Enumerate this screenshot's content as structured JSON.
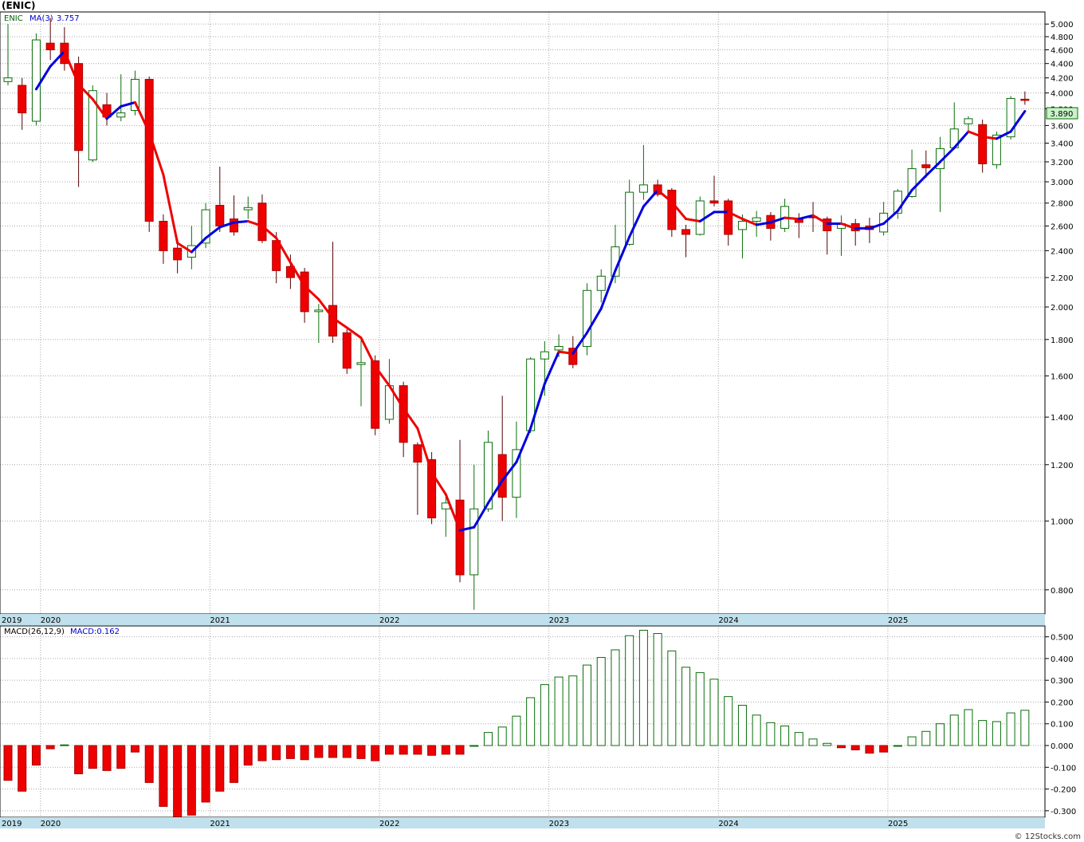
{
  "header": {
    "symbol": "(ENIC)"
  },
  "watermark": "© 12Stocks.com",
  "colors": {
    "up_body": "#ffffff",
    "up_stroke": "#0a6e0a",
    "down_body": "#ee0000",
    "down_stroke": "#aa0000",
    "ma_up": "#0000dd",
    "ma_down": "#ee0000",
    "axis_band": "#bfe0ec",
    "price_tag": "#c9f2c9"
  },
  "chart_data": [
    {
      "type": "candlestick",
      "panel": "price",
      "legend": {
        "symbol": "ENIC",
        "ma_label": "MA(3)",
        "ma_value": "3.757"
      },
      "last_price": "3.890",
      "y_scale": "log",
      "ylim": [
        0.74,
        5.2
      ],
      "y_ticks": [
        {
          "v": 0.8,
          "label": "0.800"
        },
        {
          "v": 1.0,
          "label": "1.000"
        },
        {
          "v": 1.2,
          "label": "1.200"
        },
        {
          "v": 1.4,
          "label": "1.400"
        },
        {
          "v": 1.6,
          "label": "1.600"
        },
        {
          "v": 1.8,
          "label": "1.800"
        },
        {
          "v": 2.0,
          "label": "2.000"
        },
        {
          "v": 2.2,
          "label": "2.200"
        },
        {
          "v": 2.4,
          "label": "2.400"
        },
        {
          "v": 2.6,
          "label": "2.600"
        },
        {
          "v": 2.8,
          "label": "2.800"
        },
        {
          "v": 3.0,
          "label": "3.000"
        },
        {
          "v": 3.2,
          "label": "3.200"
        },
        {
          "v": 3.4,
          "label": "3.400"
        },
        {
          "v": 3.6,
          "label": "3.600"
        },
        {
          "v": 3.8,
          "label": "3.800"
        },
        {
          "v": 4.0,
          "label": "4.000"
        },
        {
          "v": 4.2,
          "label": "4.200"
        },
        {
          "v": 4.4,
          "label": "4.400"
        },
        {
          "v": 4.6,
          "label": "4.600"
        },
        {
          "v": 4.8,
          "label": "4.800"
        },
        {
          "v": 5.0,
          "label": "5.000"
        }
      ],
      "x_labels": [
        {
          "i": -0.7,
          "label": "2019"
        },
        {
          "i": 2.3,
          "label": "2020"
        },
        {
          "i": 14.3,
          "label": "2021"
        },
        {
          "i": 26.3,
          "label": "2022"
        },
        {
          "i": 38.3,
          "label": "2023"
        },
        {
          "i": 50.3,
          "label": "2024"
        },
        {
          "i": 62.3,
          "label": "2025"
        }
      ],
      "candles": [
        {
          "o": 4.15,
          "h": 5.0,
          "l": 4.1,
          "c": 4.2
        },
        {
          "o": 4.1,
          "h": 4.2,
          "l": 3.55,
          "c": 3.75
        },
        {
          "o": 3.65,
          "h": 4.85,
          "l": 3.6,
          "c": 4.75
        },
        {
          "o": 4.7,
          "h": 5.1,
          "l": 4.45,
          "c": 4.6
        },
        {
          "o": 4.7,
          "h": 4.95,
          "l": 4.3,
          "c": 4.4
        },
        {
          "o": 4.4,
          "h": 4.5,
          "l": 2.95,
          "c": 3.32
        },
        {
          "o": 3.22,
          "h": 4.1,
          "l": 3.2,
          "c": 4.03
        },
        {
          "o": 3.85,
          "h": 4.0,
          "l": 3.6,
          "c": 3.7
        },
        {
          "o": 3.7,
          "h": 4.25,
          "l": 3.65,
          "c": 3.75
        },
        {
          "o": 3.78,
          "h": 4.3,
          "l": 3.72,
          "c": 4.18
        },
        {
          "o": 4.18,
          "h": 4.22,
          "l": 2.55,
          "c": 2.64
        },
        {
          "o": 2.64,
          "h": 2.7,
          "l": 2.3,
          "c": 2.4
        },
        {
          "o": 2.42,
          "h": 2.5,
          "l": 2.23,
          "c": 2.33
        },
        {
          "o": 2.35,
          "h": 2.6,
          "l": 2.26,
          "c": 2.44
        },
        {
          "o": 2.46,
          "h": 2.8,
          "l": 2.42,
          "c": 2.74
        },
        {
          "o": 2.78,
          "h": 3.15,
          "l": 2.55,
          "c": 2.6
        },
        {
          "o": 2.66,
          "h": 2.87,
          "l": 2.52,
          "c": 2.55
        },
        {
          "o": 2.74,
          "h": 2.86,
          "l": 2.66,
          "c": 2.76
        },
        {
          "o": 2.8,
          "h": 2.88,
          "l": 2.46,
          "c": 2.48
        },
        {
          "o": 2.48,
          "h": 2.55,
          "l": 2.16,
          "c": 2.25
        },
        {
          "o": 2.28,
          "h": 2.37,
          "l": 2.12,
          "c": 2.2
        },
        {
          "o": 2.24,
          "h": 2.27,
          "l": 1.9,
          "c": 1.97
        },
        {
          "o": 1.97,
          "h": 2.02,
          "l": 1.78,
          "c": 1.98
        },
        {
          "o": 2.01,
          "h": 2.47,
          "l": 1.78,
          "c": 1.82
        },
        {
          "o": 1.84,
          "h": 1.86,
          "l": 1.61,
          "c": 1.64
        },
        {
          "o": 1.66,
          "h": 1.8,
          "l": 1.45,
          "c": 1.67
        },
        {
          "o": 1.68,
          "h": 1.71,
          "l": 1.32,
          "c": 1.35
        },
        {
          "o": 1.39,
          "h": 1.69,
          "l": 1.37,
          "c": 1.55
        },
        {
          "o": 1.55,
          "h": 1.57,
          "l": 1.23,
          "c": 1.29
        },
        {
          "o": 1.28,
          "h": 1.29,
          "l": 1.02,
          "c": 1.21
        },
        {
          "o": 1.22,
          "h": 1.25,
          "l": 0.99,
          "c": 1.01
        },
        {
          "o": 1.04,
          "h": 1.08,
          "l": 0.95,
          "c": 1.06
        },
        {
          "o": 1.07,
          "h": 1.3,
          "l": 0.82,
          "c": 0.84
        },
        {
          "o": 0.84,
          "h": 1.2,
          "l": 0.75,
          "c": 1.04
        },
        {
          "o": 1.04,
          "h": 1.34,
          "l": 1.03,
          "c": 1.29
        },
        {
          "o": 1.24,
          "h": 1.5,
          "l": 1.0,
          "c": 1.08
        },
        {
          "o": 1.08,
          "h": 1.38,
          "l": 1.01,
          "c": 1.26
        },
        {
          "o": 1.34,
          "h": 1.7,
          "l": 1.33,
          "c": 1.69
        },
        {
          "o": 1.69,
          "h": 1.79,
          "l": 1.5,
          "c": 1.73
        },
        {
          "o": 1.74,
          "h": 1.83,
          "l": 1.7,
          "c": 1.76
        },
        {
          "o": 1.75,
          "h": 1.82,
          "l": 1.64,
          "c": 1.66
        },
        {
          "o": 1.76,
          "h": 2.16,
          "l": 1.71,
          "c": 2.11
        },
        {
          "o": 2.11,
          "h": 2.26,
          "l": 2.03,
          "c": 2.21
        },
        {
          "o": 2.21,
          "h": 2.61,
          "l": 2.16,
          "c": 2.43
        },
        {
          "o": 2.45,
          "h": 3.02,
          "l": 2.44,
          "c": 2.9
        },
        {
          "o": 2.9,
          "h": 3.38,
          "l": 2.83,
          "c": 2.97
        },
        {
          "o": 2.97,
          "h": 3.02,
          "l": 2.86,
          "c": 2.88
        },
        {
          "o": 2.92,
          "h": 2.94,
          "l": 2.51,
          "c": 2.57
        },
        {
          "o": 2.57,
          "h": 2.61,
          "l": 2.35,
          "c": 2.53
        },
        {
          "o": 2.53,
          "h": 2.86,
          "l": 2.52,
          "c": 2.82
        },
        {
          "o": 2.82,
          "h": 3.06,
          "l": 2.77,
          "c": 2.8
        },
        {
          "o": 2.82,
          "h": 2.84,
          "l": 2.44,
          "c": 2.53
        },
        {
          "o": 2.57,
          "h": 2.7,
          "l": 2.34,
          "c": 2.64
        },
        {
          "o": 2.64,
          "h": 2.73,
          "l": 2.51,
          "c": 2.67
        },
        {
          "o": 2.69,
          "h": 2.72,
          "l": 2.48,
          "c": 2.58
        },
        {
          "o": 2.58,
          "h": 2.84,
          "l": 2.55,
          "c": 2.77
        },
        {
          "o": 2.66,
          "h": 2.71,
          "l": 2.5,
          "c": 2.63
        },
        {
          "o": 2.68,
          "h": 2.81,
          "l": 2.55,
          "c": 2.67
        },
        {
          "o": 2.66,
          "h": 2.68,
          "l": 2.37,
          "c": 2.56
        },
        {
          "o": 2.58,
          "h": 2.69,
          "l": 2.36,
          "c": 2.62
        },
        {
          "o": 2.62,
          "h": 2.66,
          "l": 2.44,
          "c": 2.56
        },
        {
          "o": 2.6,
          "h": 2.67,
          "l": 2.46,
          "c": 2.57
        },
        {
          "o": 2.55,
          "h": 2.81,
          "l": 2.52,
          "c": 2.71
        },
        {
          "o": 2.71,
          "h": 2.93,
          "l": 2.66,
          "c": 2.91
        },
        {
          "o": 2.86,
          "h": 3.33,
          "l": 2.85,
          "c": 3.13
        },
        {
          "o": 3.17,
          "h": 3.32,
          "l": 3.04,
          "c": 3.14
        },
        {
          "o": 3.13,
          "h": 3.47,
          "l": 2.72,
          "c": 3.34
        },
        {
          "o": 3.35,
          "h": 3.88,
          "l": 3.33,
          "c": 3.56
        },
        {
          "o": 3.62,
          "h": 3.71,
          "l": 3.52,
          "c": 3.68
        },
        {
          "o": 3.61,
          "h": 3.67,
          "l": 3.09,
          "c": 3.18
        },
        {
          "o": 3.17,
          "h": 3.53,
          "l": 3.13,
          "c": 3.49
        },
        {
          "o": 3.47,
          "h": 3.96,
          "l": 3.44,
          "c": 3.93
        },
        {
          "o": 3.92,
          "h": 4.02,
          "l": 3.85,
          "c": 3.91
        }
      ],
      "ma": [
        null,
        null,
        4.05,
        4.36,
        4.58,
        4.11,
        3.92,
        3.68,
        3.83,
        3.88,
        3.52,
        3.07,
        2.46,
        2.39,
        2.5,
        2.59,
        2.63,
        2.64,
        2.6,
        2.5,
        2.31,
        2.14,
        2.05,
        1.93,
        1.87,
        1.81,
        1.65,
        1.55,
        1.44,
        1.35,
        1.17,
        1.09,
        0.97,
        0.98,
        1.06,
        1.14,
        1.21,
        1.35,
        1.56,
        1.73,
        1.72,
        1.84,
        1.99,
        2.25,
        2.51,
        2.77,
        2.92,
        2.81,
        2.66,
        2.64,
        2.72,
        2.72,
        2.66,
        2.61,
        2.63,
        2.67,
        2.66,
        2.69,
        2.62,
        2.62,
        2.58,
        2.58,
        2.62,
        2.73,
        2.92,
        3.06,
        3.2,
        3.35,
        3.53,
        3.47,
        3.45,
        3.53,
        3.77
      ]
    },
    {
      "type": "bar",
      "panel": "macd",
      "legend": {
        "label": "MACD(26,12,9)",
        "value_label": "MACD:0.162"
      },
      "ylim": [
        -0.33,
        0.55
      ],
      "y_ticks": [
        {
          "v": -0.3,
          "label": "-0.300"
        },
        {
          "v": -0.2,
          "label": "-0.200"
        },
        {
          "v": -0.1,
          "label": "-0.100"
        },
        {
          "v": 0.0,
          "label": "0.000"
        },
        {
          "v": 0.1,
          "label": "0.100"
        },
        {
          "v": 0.2,
          "label": "0.200"
        },
        {
          "v": 0.3,
          "label": "0.300"
        },
        {
          "v": 0.4,
          "label": "0.400"
        },
        {
          "v": 0.5,
          "label": "0.500"
        }
      ],
      "x_labels": [
        {
          "i": -0.7,
          "label": "2019"
        },
        {
          "i": 2.3,
          "label": "2020"
        },
        {
          "i": 14.3,
          "label": "2021"
        },
        {
          "i": 26.3,
          "label": "2022"
        },
        {
          "i": 38.3,
          "label": "2023"
        },
        {
          "i": 50.3,
          "label": "2024"
        },
        {
          "i": 62.3,
          "label": "2025"
        }
      ],
      "values": [
        -0.16,
        -0.21,
        -0.09,
        -0.015,
        0.003,
        -0.13,
        -0.105,
        -0.115,
        -0.105,
        -0.03,
        -0.17,
        -0.28,
        -0.33,
        -0.32,
        -0.26,
        -0.21,
        -0.17,
        -0.09,
        -0.07,
        -0.065,
        -0.06,
        -0.065,
        -0.055,
        -0.055,
        -0.055,
        -0.06,
        -0.07,
        -0.04,
        -0.04,
        -0.04,
        -0.045,
        -0.04,
        -0.04,
        0.0,
        0.06,
        0.085,
        0.135,
        0.22,
        0.28,
        0.315,
        0.32,
        0.37,
        0.405,
        0.44,
        0.505,
        0.53,
        0.515,
        0.435,
        0.36,
        0.335,
        0.305,
        0.225,
        0.185,
        0.14,
        0.105,
        0.09,
        0.06,
        0.03,
        0.01,
        -0.01,
        -0.02,
        -0.035,
        -0.03,
        0.0,
        0.04,
        0.065,
        0.1,
        0.14,
        0.165,
        0.115,
        0.11,
        0.15,
        0.162
      ]
    }
  ]
}
